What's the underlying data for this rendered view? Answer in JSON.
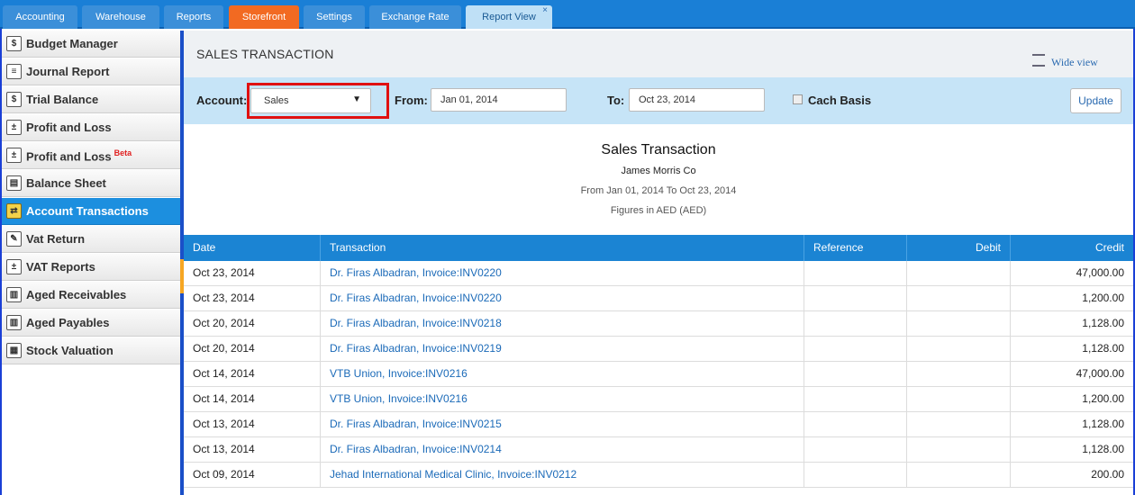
{
  "tabs": [
    {
      "label": "Accounting"
    },
    {
      "label": "Warehouse"
    },
    {
      "label": "Reports"
    },
    {
      "label": "Storefront"
    },
    {
      "label": "Settings"
    },
    {
      "label": "Exchange Rate"
    },
    {
      "label": "Report View",
      "close": "×"
    }
  ],
  "sidebar": {
    "items": [
      {
        "label": "Budget Manager",
        "icon": "budget-icon"
      },
      {
        "label": "Journal Report",
        "icon": "journal-icon"
      },
      {
        "label": "Trial Balance",
        "icon": "dollar-icon"
      },
      {
        "label": "Profit and Loss",
        "icon": "calculator-icon"
      },
      {
        "label": "Profit and Loss",
        "icon": "calculator-icon",
        "badge": "Beta"
      },
      {
        "label": "Balance Sheet",
        "icon": "sheet-icon"
      },
      {
        "label": "Account Transactions",
        "icon": "transactions-icon"
      },
      {
        "label": "Vat Return",
        "icon": "vat-return-icon"
      },
      {
        "label": "VAT Reports",
        "icon": "vat-reports-icon"
      },
      {
        "label": "Aged Receivables",
        "icon": "receivables-icon"
      },
      {
        "label": "Aged Payables",
        "icon": "payables-icon"
      },
      {
        "label": "Stock Valuation",
        "icon": "stock-icon"
      }
    ]
  },
  "header": {
    "title": "SALES TRANSACTION",
    "wide_view": "Wide view"
  },
  "filter": {
    "account_label": "Account:",
    "account_value": "Sales",
    "from_label": "From:",
    "from_value": "Jan 01, 2014",
    "to_label": "To:",
    "to_value": "Oct 23, 2014",
    "cash_basis_label": "Cach Basis",
    "update_label": "Update"
  },
  "report": {
    "title": "Sales Transaction",
    "company": "James Morris Co",
    "range": "From Jan 01, 2014 To Oct 23, 2014",
    "figures": "Figures in AED (AED)"
  },
  "table": {
    "columns": [
      "Date",
      "Transaction",
      "Reference",
      "Debit",
      "Credit"
    ],
    "rows": [
      {
        "date": "Oct 23, 2014",
        "transaction": "Dr. Firas Albadran, Invoice:INV0220",
        "reference": "",
        "debit": "",
        "credit": "47,000.00"
      },
      {
        "date": "Oct 23, 2014",
        "transaction": "Dr. Firas Albadran, Invoice:INV0220",
        "reference": "",
        "debit": "",
        "credit": "1,200.00"
      },
      {
        "date": "Oct 20, 2014",
        "transaction": "Dr. Firas Albadran, Invoice:INV0218",
        "reference": "",
        "debit": "",
        "credit": "1,128.00"
      },
      {
        "date": "Oct 20, 2014",
        "transaction": "Dr. Firas Albadran, Invoice:INV0219",
        "reference": "",
        "debit": "",
        "credit": "1,128.00"
      },
      {
        "date": "Oct 14, 2014",
        "transaction": "VTB Union, Invoice:INV0216",
        "reference": "",
        "debit": "",
        "credit": "47,000.00"
      },
      {
        "date": "Oct 14, 2014",
        "transaction": "VTB Union, Invoice:INV0216",
        "reference": "",
        "debit": "",
        "credit": "1,200.00"
      },
      {
        "date": "Oct 13, 2014",
        "transaction": "Dr. Firas Albadran, Invoice:INV0215",
        "reference": "",
        "debit": "",
        "credit": "1,128.00"
      },
      {
        "date": "Oct 13, 2014",
        "transaction": "Dr. Firas Albadran, Invoice:INV0214",
        "reference": "",
        "debit": "",
        "credit": "1,128.00"
      },
      {
        "date": "Oct 09, 2014",
        "transaction": "Jehad International Medical Clinic, Invoice:INV0212",
        "reference": "",
        "debit": "",
        "credit": "200.00"
      }
    ]
  }
}
